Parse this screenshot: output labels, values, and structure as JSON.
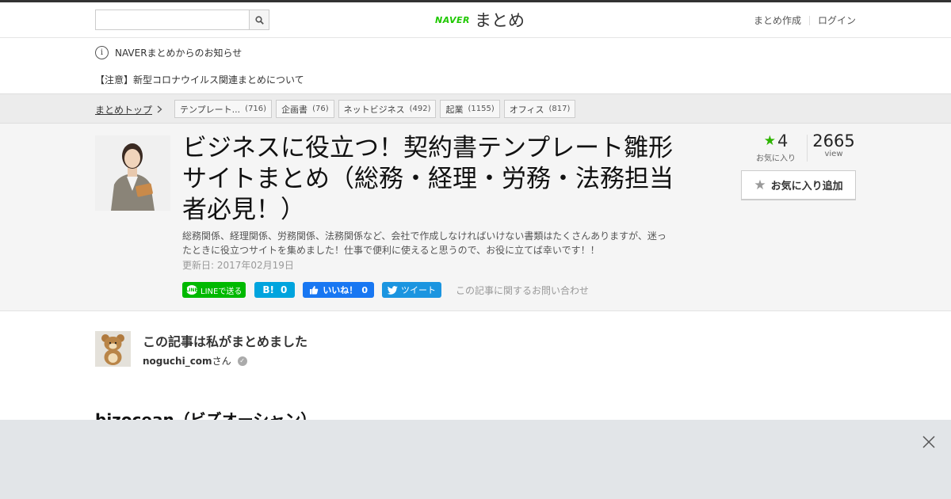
{
  "header": {
    "search": {
      "value": "",
      "placeholder": ""
    },
    "logo": {
      "brand": "NAVER",
      "name": "まとめ"
    },
    "links": {
      "create": "まとめ作成",
      "login": "ログイン"
    }
  },
  "notice": {
    "heading": "NAVERまとめからのお知らせ",
    "item": "【注意】新型コロナウイルス関連まとめについて"
  },
  "breadcrumb": {
    "top_label": "まとめトップ",
    "tags": [
      {
        "label": "テンプレート...",
        "count": "(716)"
      },
      {
        "label": "企画書",
        "count": "(76)"
      },
      {
        "label": "ネットビジネス",
        "count": "(492)"
      },
      {
        "label": "起業",
        "count": "(1155)"
      },
      {
        "label": "オフィス",
        "count": "(817)"
      }
    ]
  },
  "article": {
    "title": "ビジネスに役立つ！契約書テンプレート雛形サイトまとめ（総務・経理・労務・法務担当者必見！）",
    "description": "総務関係、経理関係、労務関係、法務関係など、会社で作成しなければいけない書類はたくさんありますが、迷ったときに役立つサイトを集めました！仕事で便利に使えると思うので、お役に立てば幸いです！！",
    "updated": "更新日: 2017年02月19日",
    "share": {
      "line": "LINEで送る",
      "hatena_count": "0",
      "facebook_label": "いいね！",
      "facebook_count": "0",
      "twitter": "ツイート",
      "contact": "この記事に関するお問い合わせ"
    },
    "stats": {
      "favorites": "4",
      "favorites_label": "お気に入り",
      "views": "2665",
      "views_label": "view"
    },
    "favorite_button": "お気に入り追加"
  },
  "author": {
    "heading": "この記事は私がまとめました",
    "username": "noguchi_com",
    "suffix": "さん"
  },
  "section": {
    "title": "bizocean（ビズオーシャン）"
  },
  "colors": {
    "naver_green": "#1ec800",
    "line_green": "#00b900",
    "hatena_blue": "#00a4de",
    "facebook_blue": "#1877f2",
    "twitter_blue": "#1b95e0"
  }
}
